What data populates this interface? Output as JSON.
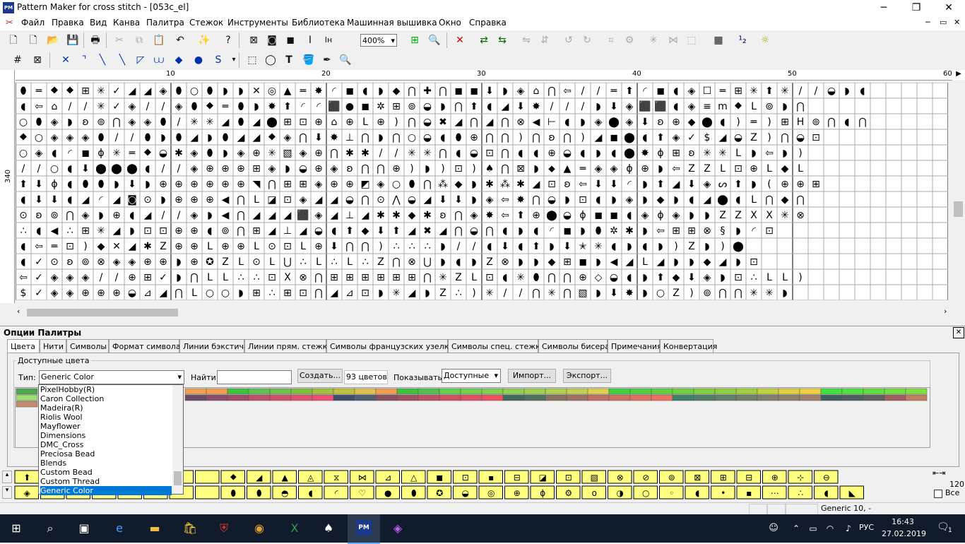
{
  "window": {
    "title": "Pattern Maker for cross stitch - [053c_el]",
    "icon_text": "PM",
    "minimize": "─",
    "restore": "❐",
    "close": "✕",
    "doc_minimize": "─",
    "doc_restore": "▭",
    "doc_close": "✕"
  },
  "menu": [
    "Файл",
    "Правка",
    "Вид",
    "Канва",
    "Палитра",
    "Стежок",
    "Инструменты",
    "Библиотека",
    "Машинная вышивка",
    "Окно",
    "Справка"
  ],
  "toolbar": {
    "zoom": "400%"
  },
  "ruler": {
    "labels": [
      "10",
      "20",
      "30",
      "40",
      "50",
      "60"
    ],
    "vlabel": "340"
  },
  "grid_symbols": [
    "⬮═⯁⯁⊞✳✓◢◢◈⬮○⬮◗◗✕◎▲═✸◜◼◖◗◆⋂✚⋂◼◼⬇◗◈⌂⋂⇦//═⬆◜◼◖◈☐═⊞✳⬆✳//◒◗◖",
    "◖⇦⌂//✳✓◈//◈⬮⯁═⬮◗✸⬆◜◜⬛●◼✲⊞⊚◒◗⋂⬆◖◢⬇✸///◗⬇◈⬛⬛◖◈≡m⯁L⊚◗⋂",
    "○⬮◈◗ʚ⊚⋂◈◈⬮/✳✳◢⬮◢⬤⊞⊡⊕⌂⊕L⊕)⋂◒✖◢⋂◢⋂⊗◀⊢◖◗◈⬤◈⬇ʚ⊕◆⬤◖)═)⊞H⊚⋂◖⋂",
    "⯁○◈◈◈⬮//⬮◗⬮◢◗⬮◢◢⯁◈⋂⬇✸⊥⋂◗⋂○◒◖⬮⊕⋂⋂)⋂ʚ⋂)◢◼⬤◖⬆◈✓$◢◒Z)⋂◒⊡",
    "○◈◖◜◼ɸ✳═⯁◒✱◈⬮◗◈⊕✳▧◈⊕⋂✱✱//✳✳⋂◖◒⊡⋂◖◖⊕◒◖◗◖⬤✸ɸ⊞ʚ✳✳L◗⇦◗)",
    "//○◖⬇⬤⬤⬤◖//◈⊕⊕⊕⊞◈◗◒⊕◈ʚ⋂⋂⊕)◗)⊡)♠⋂⊠◗⬥▲═◈◈ɸ⊕◗⇦ZZL⊡⊕L◆L",
    "⬆⬇ɸ◖⬮⬮◗⬇◗⊕⊕⊕⊕⊕⊕◥⋂⊞⊞◈⊕⊕◩◈○⬮⋂⁂◆◗✱⁂✱◢⊡ʚ⇦⬇⬇◜◗⬆◢⬇◈ᔕ⬆◗(⊕⊕⊞",
    "◖⬇⬇◖◢◜◢◙⊙◗⊕⊕⊕◀⋂L◪⊡◈◢◢◒⋂⊙⋀◒◢⬇⬇◗◈⇦✸⋂◒◗⊡◖◗◈◗◆◗◖◢⬤◖L⋂◆⋂",
    "⊙ʚ⊚⋂◈◗⊕◖◢//◈◗◀⋂◢◢◢⬛◈◢⊥◢✱✱◆✱ʚ⋂◈✸⇦⬆⊕⬤◒ɸ◼◼◖◈ɸ◈◗◗ZZXX✳⊗",
    "∴◖◀∴⊞✳◢◗⊡⊡⊕⊕◖⊚⋂⊞◢⊥◢◒◖⬆◆⬇⬆◢✖◢⋂◒⋂◖◗◖◜◼◗⬮✲✱◗⇦⊞⊞⊗§◗◜⊡",
    "◖⇦═⊡)◆✕◢✱Z⊕⊕L⊕⊕L⊙⊡L⊕⬇⋂⋂)∴∴∴◗//◖⬇◖⬆◗⬇✭✳◖◗◖◗)Z◗)⬤",
    "◖✓⊙ʚ⊚⊗◈◈⊕⊕◗⊕✪ZL⊙L⋃∴L∴L∴Z⋂⊗⋃◗◖◗Z⊗◗◗◆⊞◼◗◀◢L◢◗◗◆◢◗⊡",
    "⇦✓◈◈◈//⊕⊞✓◗⋂LL∴∴⊡X⊗⋂⊞⊞⊞⊞⊞⊞⋂✳ZL⊡◖✳⬮⋂⋂⊕◇◒◖◗⬆◆⬇◈◗⊡∴LL)",
    "$✓◈◈⊕⊕⊕◒⊿◢⋂L○○◗⊞∴⊞⊡⋂◢⊿⊡◗✳◢◗Z∴)✳//⋂✳⋂▧◗⬇✸◗○Z)⊚⋂⋂✳✳◗"
  ],
  "panel": {
    "title": "Опции Палитры",
    "close": "✕",
    "tabs": [
      "Цвета",
      "Нити",
      "Символы",
      "Формат символа",
      "Линии бэкстича",
      "Линии прям. стежка",
      "Символы французских узелков",
      "Символы спец. стежка",
      "Символы бисера",
      "Примечания",
      "Конвертация"
    ],
    "group_label": "Доступные цвета",
    "type_label": "Тип:",
    "type_value": "Generic Color",
    "find_label": "Найти:",
    "find_value": "",
    "create_button": "Создать...",
    "count_text": "93 цветов",
    "show_label": "Показывать:",
    "show_value": "Доступные",
    "import_button": "Импорт...",
    "export_button": "Экспорт...",
    "dropdown_options": [
      "PixelHobby(R)",
      "Caron Collection",
      "Madeira(R)",
      "Riolis Wool",
      "Mayflower",
      "Dimensions",
      "DMC_Cross",
      "Preciosa Bead",
      "Blends",
      "Custom Bead",
      "Custom Thread",
      "Generic Color"
    ],
    "dropdown_selected": "Generic Color"
  },
  "swatch_colors_top": [
    "#4ea84e",
    "#a0e070",
    "#c48a6e"
  ],
  "swatch_row1": [
    "#f0a050",
    "#f0a050",
    "#40c040",
    "#60c050",
    "#70c050",
    "#80c040",
    "#a0c040",
    "#c0c040",
    "#e0c050",
    "#f0a050",
    "#40c040",
    "#50c050",
    "#60d050",
    "#70d050",
    "#80d050",
    "#90d050",
    "#a0d050",
    "#b0d050",
    "#c0d050",
    "#e0d050",
    "#40d040",
    "#50d040",
    "#60d040",
    "#70d040",
    "#80d040",
    "#90d040",
    "#a0d040",
    "#c0d040",
    "#e0d040",
    "#f0d040",
    "#40e040",
    "#50e040",
    "#60e040",
    "#70e040",
    "#80e040"
  ],
  "swatch_row2": [
    "#6a4c6a",
    "#8a4c6a",
    "#a04c6a",
    "#c0506a",
    "#d0506a",
    "#e05070",
    "#f05070",
    "#404c6a",
    "#506070",
    "#8a5060",
    "#a05060",
    "#c05060",
    "#d05060",
    "#e05060",
    "#f05060",
    "#406a60",
    "#507060",
    "#8a7060",
    "#a07060",
    "#c07060",
    "#d07060",
    "#e07060",
    "#f07060",
    "#40806a",
    "#50806a",
    "#60806a",
    "#70806a",
    "#80806a",
    "#90806a",
    "#a0806a",
    "#406060",
    "#506060",
    "#606060",
    "#a06060",
    "#c08060"
  ],
  "palette_row1": [
    "⬆",
    "",
    "",
    "",
    "",
    "",
    "",
    "",
    "⯁",
    "◢",
    "▲",
    "◬",
    "⧖",
    "⋈",
    "⊿",
    "△",
    "◼",
    "⊡",
    "▪",
    "⊟",
    "◪",
    "⊡",
    "▧",
    "⊗",
    "⊘",
    "⊚",
    "⊠",
    "⊞",
    "⊟",
    "⊕",
    "⊹",
    "⊖"
  ],
  "palette_row2": [
    "◈",
    "",
    "",
    "",
    "",
    "",
    "",
    "",
    "⬮",
    "⬮",
    "◓",
    "◖",
    "◜",
    "♡",
    "●",
    "⬮",
    "✪",
    "◒",
    "◎",
    "⊕",
    "ɸ",
    "⚙",
    "o",
    "◑",
    "○",
    "◦",
    "◖",
    "•",
    "▪",
    "⋯",
    "∴",
    "◖",
    "◣"
  ],
  "side": {
    "count": "120",
    "all_label": "Все"
  },
  "status": {
    "text": "Generic  10, -"
  },
  "taskbar": {
    "time": "16:43",
    "date": "27.02.2019",
    "lang": "РУС",
    "notif_count": "1"
  }
}
